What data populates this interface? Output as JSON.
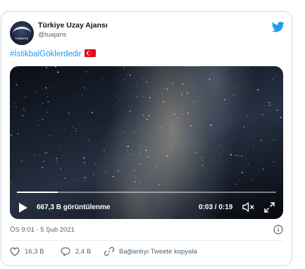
{
  "tweet": {
    "author_name": "Türkiye Uzay Ajansı",
    "author_handle": "@tuajans",
    "avatar_text": "TÜRKİYE",
    "hashtag": "#İstikbalGöklerdedir",
    "flag_icon": "turkey-flag-icon",
    "timestamp": "ÖS 9:01 · 5 Şub 2021"
  },
  "video": {
    "views_label": "667,3 B görüntülenme",
    "time_label": "0:03 / 0:19",
    "progress_fraction": 0.158
  },
  "actions": {
    "likes_count": "16,3 B",
    "replies_count": "2,4 B",
    "copy_link_label": "Bağlantıyı Tweete kopyala"
  },
  "colors": {
    "accent": "#1d9bf0",
    "muted_text": "#536471",
    "border": "#cfd9de"
  }
}
